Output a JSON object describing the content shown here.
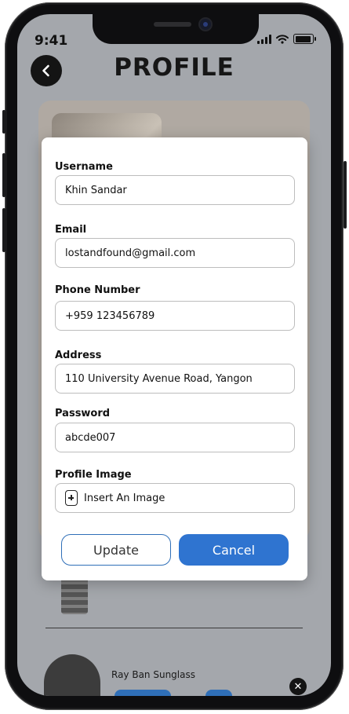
{
  "status": {
    "time": "9:41"
  },
  "header": {
    "title": "PROFILE"
  },
  "background": {
    "item_name": "Ray Ban Sunglass"
  },
  "form": {
    "username": {
      "label": "Username",
      "value": "Khin Sandar"
    },
    "email": {
      "label": "Email",
      "value": "lostandfound@gmail.com"
    },
    "phone": {
      "label": "Phone Number",
      "value": "+959 123456789"
    },
    "address": {
      "label": "Address",
      "value": "110 University Avenue Road, Yangon"
    },
    "password": {
      "label": "Password",
      "value": "abcde007"
    },
    "profile_image": {
      "label": "Profile Image",
      "button_label": "Insert An Image"
    }
  },
  "buttons": {
    "update": "Update",
    "cancel": "Cancel"
  },
  "colors": {
    "primary": "#2f74d0",
    "overlay": "#a4a7ac"
  },
  "icons": {
    "back": "chevron-left-icon",
    "close": "close-icon",
    "add_file": "file-plus-icon"
  }
}
